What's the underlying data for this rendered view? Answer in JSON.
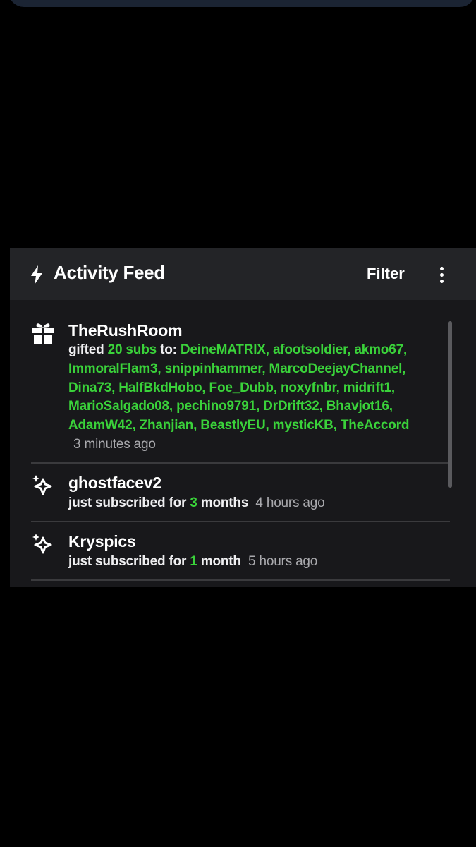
{
  "panel": {
    "title": "Activity Feed",
    "filter_label": "Filter",
    "header_icon": "bolt-icon",
    "menu_icon": "kebab-menu-icon"
  },
  "colors": {
    "accent_green": "#3ad23a",
    "panel_bg": "#18181b",
    "header_bg": "#232427"
  },
  "feed": {
    "items": [
      {
        "icon": "gift-icon",
        "username": "TheRushRoom",
        "action": "gifted",
        "amount": "20 subs",
        "to_label": "to:",
        "recipients_lines": [
          "DeineMATRIX, afootsoldier, akmo67,",
          "ImmoralFlam3, snippinhammer, MarcoDeejayChannel,",
          "Dina73, HalfBkdHobo, Foe_Dubb, noxyfnbr, midrift1,",
          "MarioSalgado08, pechino9791, DrDrift32, Bhavjot16,",
          "AdamW42, Zhanjian, BeastlyEU, mysticKB, TheAccord"
        ],
        "time": "3 minutes ago"
      },
      {
        "icon": "sparkle-icon",
        "username": "ghostfacev2",
        "action": "just subscribed for",
        "count": "3",
        "unit": "months",
        "time": "4 hours ago"
      },
      {
        "icon": "sparkle-icon",
        "username": "Kryspics",
        "action": "just subscribed for",
        "count": "1",
        "unit": "month",
        "time": "5 hours ago"
      }
    ]
  }
}
